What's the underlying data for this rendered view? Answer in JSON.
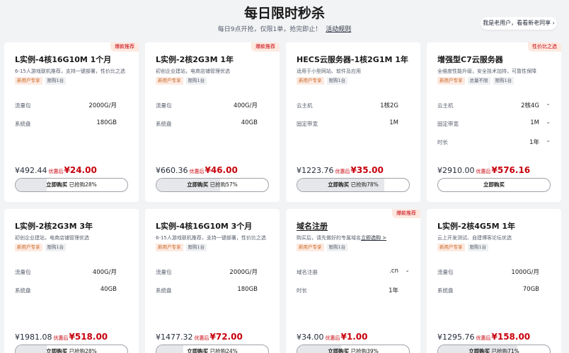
{
  "header": {
    "title": "每日限时秒杀",
    "subtitle": "每日9点开抢，仅限1单，抢完即止！",
    "rules_link": "活动规则",
    "old_user_button": "我是老用户，看看新老同享 ›"
  },
  "colors": {
    "accent": "#c7000b",
    "tag_orange_bg": "#fde9e0"
  },
  "cards": [
    {
      "badge": "爆款推荐",
      "title": "L实例-4核16G10M 1个月",
      "desc": "6-15人游戏联机推荐，支持一键部署，性价比之选",
      "tags": [
        "新用户专享",
        "限购1台"
      ],
      "specs": [
        {
          "label": "流量包",
          "value": "2000G/月"
        },
        {
          "label": "系统盘",
          "value": "180GB"
        }
      ],
      "original_price": "¥492.44",
      "discount_label": "优惠后",
      "discount_price": "¥24.00",
      "buy_label": "立即购买",
      "sold_text": "已抢购28%",
      "sold_fraction": 0.28
    },
    {
      "badge": "爆款推荐",
      "title": "L实例-2核2G3M 1年",
      "desc": "初创企业建站，电商店铺管理优选",
      "tags": [
        "新用户专享",
        "限购1台"
      ],
      "specs": [
        {
          "label": "流量包",
          "value": "400G/月"
        },
        {
          "label": "系统盘",
          "value": "40GB"
        }
      ],
      "original_price": "¥660.36",
      "discount_label": "优惠后",
      "discount_price": "¥46.00",
      "buy_label": "立即购买",
      "sold_text": "已抢购57%",
      "sold_fraction": 0.57
    },
    {
      "badge": "",
      "title": "HECS云服务器-1核2G1M 1年",
      "desc": "适用于小型网站、软件及应用",
      "tags": [
        "新用户专享",
        "限购1台"
      ],
      "specs": [
        {
          "label": "云主机",
          "value": "1核2G"
        },
        {
          "label": "固定带宽",
          "value": "1M"
        }
      ],
      "original_price": "¥1223.76",
      "discount_label": "优惠后",
      "discount_price": "¥35.00",
      "buy_label": "立即购买",
      "sold_text": "已抢购78%",
      "sold_fraction": 0.78
    },
    {
      "badge": "性价比之选",
      "title": "增强型C7云服务器",
      "desc": "全维度性能升级，安全技术加持，可靠性保障",
      "tags": [
        "新用户专享",
        "总量不限",
        "限购1台"
      ],
      "specs": [
        {
          "label": "云主机",
          "value": "2核4G",
          "dropdown": true
        },
        {
          "label": "固定带宽",
          "value": "1M",
          "dropdown": true
        },
        {
          "label": "时长",
          "value": "1年",
          "dropdown": true
        }
      ],
      "original_price": "¥2910.00",
      "discount_label": "优惠后",
      "discount_price": "¥576.16",
      "buy_label": "立即购买",
      "sold_text": "",
      "sold_fraction": 0
    },
    {
      "badge": "",
      "title": "L实例-2核2G3M 3年",
      "desc": "初创企业建站，电商店铺管理优选",
      "tags": [
        "新用户专享",
        "限购1台"
      ],
      "specs": [
        {
          "label": "流量包",
          "value": "400G/月"
        },
        {
          "label": "系统盘",
          "value": "40GB"
        }
      ],
      "original_price": "¥1981.08",
      "discount_label": "优惠后",
      "discount_price": "¥518.00",
      "buy_label": "立即购买",
      "sold_text": "已抢购28%",
      "sold_fraction": 0.28
    },
    {
      "badge": "",
      "title": "L实例-4核16G10M 3个月",
      "desc": "6-15人游戏联机推荐，支持一键部署，性价比之选",
      "tags": [
        "新用户专享",
        "限购1台"
      ],
      "specs": [
        {
          "label": "流量包",
          "value": "2000G/月"
        },
        {
          "label": "系统盘",
          "value": "180GB"
        }
      ],
      "original_price": "¥1477.32",
      "discount_label": "优惠后",
      "discount_price": "¥72.00",
      "buy_label": "立即购买",
      "sold_text": "已抢购24%",
      "sold_fraction": 0.24
    },
    {
      "badge": "爆款推荐",
      "title": "域名注册",
      "title_link": true,
      "desc": "购买后，请先做好的专属域名",
      "desc_link": "立即选购 >",
      "tags": [
        "新用户专享",
        "限购1台"
      ],
      "specs": [
        {
          "label": "域名注册",
          "value": ".cn",
          "dropdown": true
        },
        {
          "label": "时长",
          "value": "1年"
        }
      ],
      "original_price": "¥34.00",
      "discount_label": "优惠后",
      "discount_price": "¥1.00",
      "buy_label": "立即购买",
      "sold_text": "已抢购39%",
      "sold_fraction": 0.39
    },
    {
      "badge": "",
      "title": "L实例-2核4G5M 1年",
      "desc": "云上开发测试、自建博客论坛优选",
      "tags": [
        "新用户专享",
        "限购1台"
      ],
      "specs": [
        {
          "label": "流量包",
          "value": "1000G/月"
        },
        {
          "label": "系统盘",
          "value": "70GB"
        }
      ],
      "original_price": "¥1295.76",
      "discount_label": "优惠后",
      "discount_price": "¥158.00",
      "buy_label": "立即购买",
      "sold_text": "已抢购71%",
      "sold_fraction": 0.71
    }
  ]
}
